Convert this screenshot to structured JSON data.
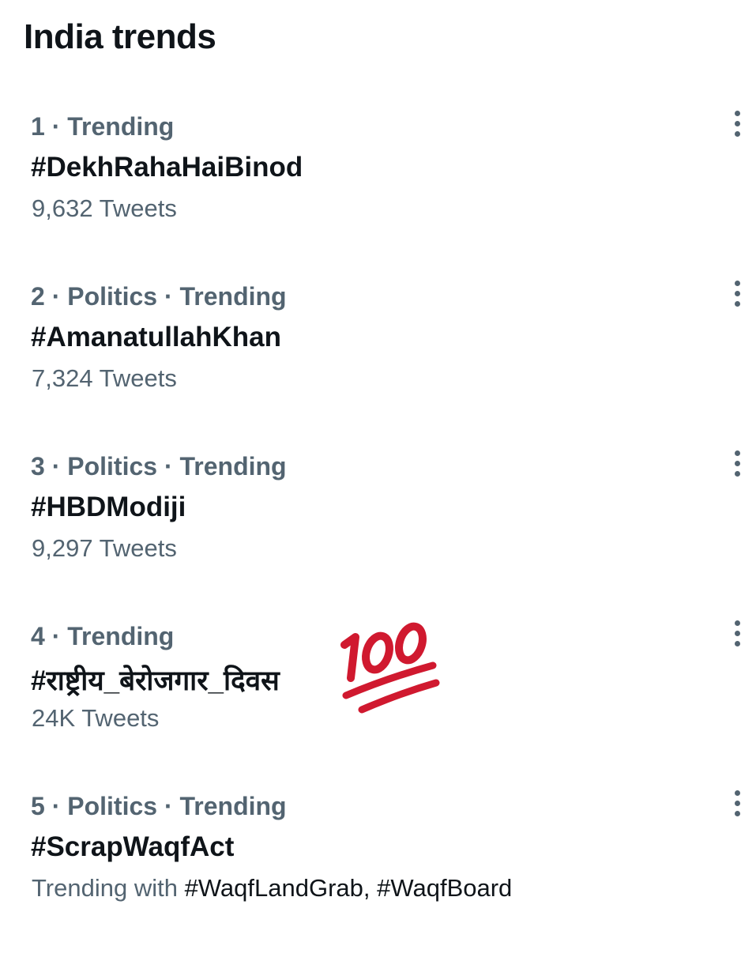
{
  "page": {
    "title": "India trends"
  },
  "trends": [
    {
      "rank": "1",
      "meta": "1 · Trending",
      "name": "#DekhRahaHaiBinod",
      "count": "9,632 Tweets",
      "more_icon": "more-vertical-icon"
    },
    {
      "rank": "2",
      "meta": "2 · Politics · Trending",
      "name": "#AmanatullahKhan",
      "count": "7,324 Tweets",
      "more_icon": "more-vertical-icon"
    },
    {
      "rank": "3",
      "meta": "3 · Politics · Trending",
      "name": "#HBDModiji",
      "count": "9,297 Tweets",
      "more_icon": "more-vertical-icon"
    },
    {
      "rank": "4",
      "meta": "4 · Trending",
      "name": "#राष्ट्रीय_बेरोजगार_दिवस",
      "count": "24K Tweets",
      "more_icon": "more-vertical-icon"
    },
    {
      "rank": "5",
      "meta": "5 · Politics · Trending",
      "name": "#ScrapWaqfAct",
      "trending_with_prefix": "Trending with",
      "trending_with_tags": "#WaqfLandGrab, #WaqfBoard",
      "more_icon": "more-vertical-icon"
    }
  ],
  "overlay": {
    "emoji": "hundred-points-emoji",
    "emoji_color": "#d0192f"
  },
  "colors": {
    "primary_text": "#0f1419",
    "secondary_text": "#536471",
    "background": "#ffffff"
  }
}
